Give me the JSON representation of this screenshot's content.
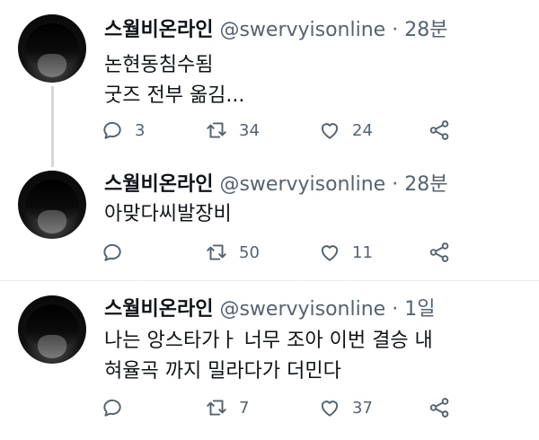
{
  "tweets": [
    {
      "name": "스월비온라인",
      "handle": "@swervyisonline",
      "dot": "·",
      "time": "28분",
      "lines": [
        "논현동침수됨",
        "굿즈 전부 옮김..."
      ],
      "replies": "3",
      "retweets": "34",
      "likes": "24"
    },
    {
      "name": "스월비온라인",
      "handle": "@swervyisonline",
      "dot": "·",
      "time": "28분",
      "lines": [
        "아맞다씨발장비"
      ],
      "replies": "",
      "retweets": "50",
      "likes": "11"
    },
    {
      "name": "스월비온라인",
      "handle": "@swervyisonline",
      "dot": "·",
      "time": "1일",
      "lines": [
        "나는 앙스타가ㅏ 너무 조아 이번 결승 내",
        "혀율곡 까지 밀라다가 더민다"
      ],
      "replies": "",
      "retweets": "7",
      "likes": "37"
    }
  ],
  "icons": {
    "reply": "reply-icon",
    "retweet": "retweet-icon",
    "like": "heart-icon",
    "share": "share-icon"
  },
  "colors": {
    "text": "#0f1419",
    "secondary": "#536471",
    "thread_line": "#cfd9de",
    "divider": "#e6ecf0"
  }
}
